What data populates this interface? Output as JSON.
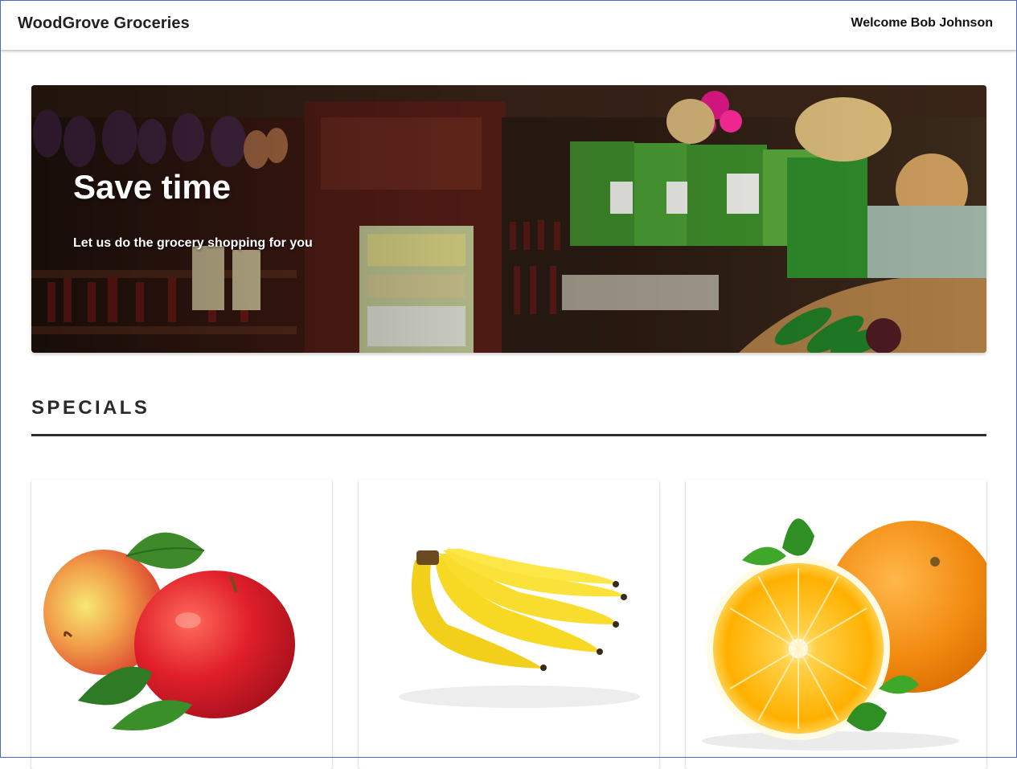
{
  "header": {
    "brand": "WoodGrove Groceries",
    "welcome": "Welcome Bob Johnson"
  },
  "hero": {
    "title": "Save time",
    "subtitle": "Let us do the grocery shopping for you"
  },
  "specials": {
    "heading": "SPECIALS",
    "items": [
      {
        "image": "apples-image"
      },
      {
        "image": "bananas-image"
      },
      {
        "image": "oranges-image"
      }
    ]
  },
  "colors": {
    "text_dark": "#212121",
    "rule": "#2f2f33",
    "frame": "#4a67c9"
  }
}
